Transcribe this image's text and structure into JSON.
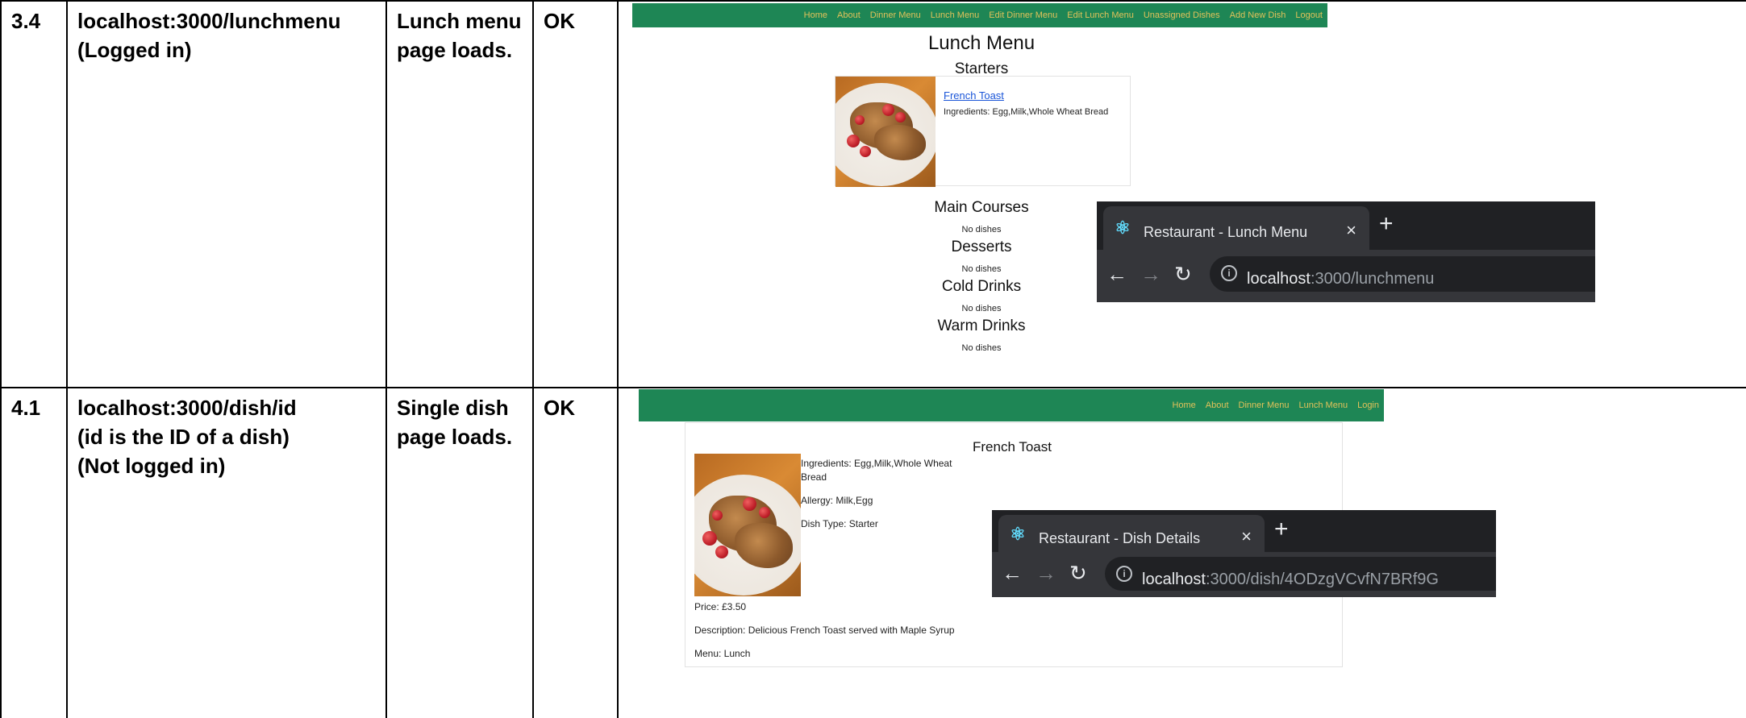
{
  "rows": [
    {
      "id": "3.4",
      "url_lines": [
        "localhost:3000/lunchmenu",
        "(Logged in)"
      ],
      "expected_lines": [
        "Lunch menu",
        "page loads."
      ],
      "result": "OK",
      "screenshot": {
        "nav": [
          "Home",
          "About",
          "Dinner Menu",
          "Lunch Menu",
          "Edit Dinner Menu",
          "Edit Lunch Menu",
          "Unassigned Dishes",
          "Add New Dish",
          "Logout"
        ],
        "page_title": "Lunch Menu",
        "starters_heading": "Starters",
        "dish": {
          "name": "French Toast",
          "ingredients": "Ingredients: Egg,Milk,Whole Wheat Bread"
        },
        "sections": [
          {
            "heading": "Main Courses",
            "empty_text": "No dishes"
          },
          {
            "heading": "Desserts",
            "empty_text": "No dishes"
          },
          {
            "heading": "Cold Drinks",
            "empty_text": "No dishes"
          },
          {
            "heading": "Warm Drinks",
            "empty_text": "No dishes"
          }
        ],
        "browser": {
          "tab_title": "Restaurant - Lunch Menu",
          "url_host": "localhost",
          "url_path": ":3000/lunchmenu"
        }
      }
    },
    {
      "id": "4.1",
      "url_lines": [
        "localhost:3000/dish/id",
        "(id is the ID of a dish)",
        "(Not logged in)"
      ],
      "expected_lines": [
        "Single dish",
        "page loads."
      ],
      "result": "OK",
      "screenshot": {
        "nav": [
          "Home",
          "About",
          "Dinner Menu",
          "Lunch Menu",
          "Login"
        ],
        "dish_title": "French Toast",
        "ingredients_lines": [
          "Ingredients: Egg,Milk,Whole Wheat",
          "Bread"
        ],
        "allergy": "Allergy: Milk,Egg",
        "dish_type": "Dish Type: Starter",
        "price": "Price: £3.50",
        "description": "Description: Delicious French Toast served with Maple Syrup",
        "menu": "Menu: Lunch",
        "browser": {
          "tab_title": "Restaurant - Dish Details",
          "url_host": "localhost",
          "url_path": ":3000/dish/4ODzgVCvfN7BRf9G"
        }
      }
    }
  ],
  "icons": {
    "close": "×",
    "new_tab": "+",
    "back": "←",
    "forward": "→",
    "reload": "↻",
    "info": "i",
    "react": "⚛"
  },
  "colors": {
    "nav_background": "#1e8655",
    "nav_link": "#e1c25a",
    "link": "#1a55d8",
    "browser_dark": "#202124"
  }
}
